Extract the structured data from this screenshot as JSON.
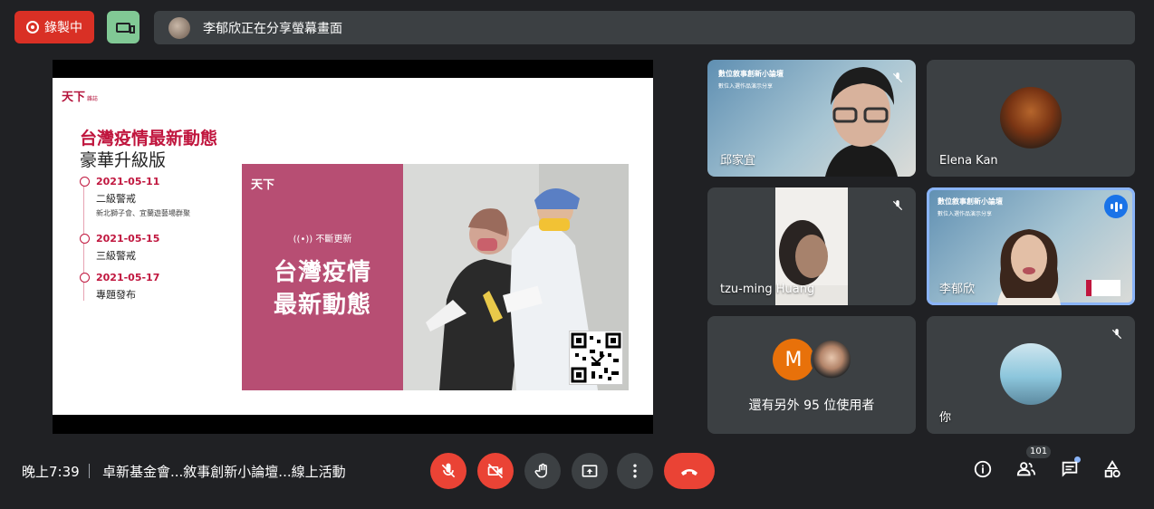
{
  "topbar": {
    "recording_label": "錄製中",
    "presenting_text": "李郁欣正在分享螢幕畫面"
  },
  "slide": {
    "logo_text": "天下",
    "logo_small": "雜誌",
    "title_line1": "台灣疫情最新動態",
    "title_line2": "豪華升級版",
    "timeline": [
      {
        "date": "2021-05-11",
        "label": "二級警戒",
        "sub": "新北獅子會、宜蘭遊藝場群聚"
      },
      {
        "date": "2021-05-15",
        "label": "三級警戒",
        "sub": ""
      },
      {
        "date": "2021-05-17",
        "label": "專題發布",
        "sub": ""
      }
    ],
    "banner_logo": "天下",
    "banner_live": "((•)) 不斷更新",
    "banner_title_line1": "台灣疫情",
    "banner_title_line2": "最新動態"
  },
  "tiles": {
    "t1_caption1": "數位敘事創新小論壇",
    "t1_caption2": "數位入選作品演示分享",
    "t1_name": "邱家宜",
    "t2_name": "Elena Kan",
    "t3_name": "tzu-ming Huang",
    "t4_caption1": "數位敘事創新小論壇",
    "t4_caption2": "數位入選作品演示分享",
    "t4_name": "李郁欣",
    "t5_initial": "M",
    "t5_text": "還有另外 95 位使用者",
    "t6_name": "你"
  },
  "bottombar": {
    "time": "晚上7:39",
    "meeting_title": "卓新基金會...敘事創新小論壇...線上活動",
    "people_count": "101"
  },
  "colors": {
    "background": "#202124",
    "tile": "#3c4043",
    "danger": "#ea4335",
    "accent_green": "#81c995",
    "accent_blue": "#1a73e8",
    "slide_red": "#c0163e",
    "banner_pink": "#b74e73"
  }
}
